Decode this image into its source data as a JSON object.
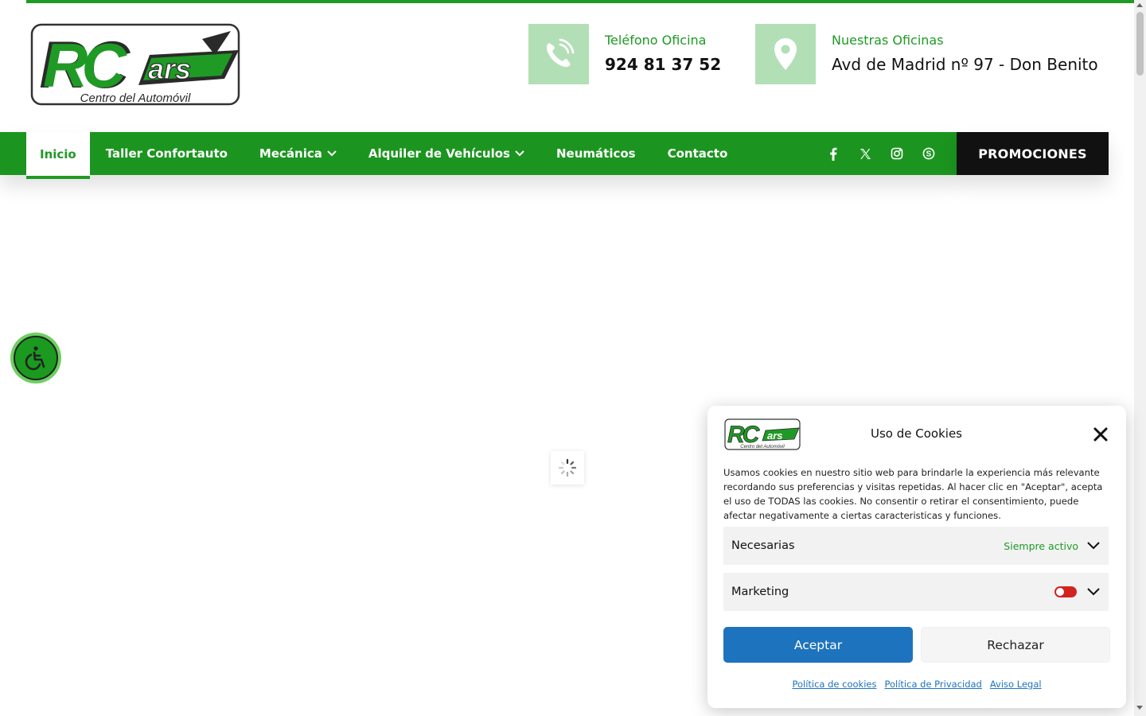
{
  "brand": {
    "logo_text": "RC Cars",
    "logo_subtitle": "Centro del Automóvil",
    "green": "#1b951f",
    "light_green": "#b3dfb6",
    "dark": "#111111"
  },
  "header": {
    "phone": {
      "icon": "phone-icon",
      "label": "Teléfono Oficina",
      "value": "924 81 37 52"
    },
    "office": {
      "icon": "location-pin-icon",
      "label": "Nuestras Oficinas",
      "value": "Avd de Madrid nº 97 - Don Benito"
    }
  },
  "nav": {
    "items": [
      {
        "label": "Inicio",
        "active": true
      },
      {
        "label": "Taller Confortauto"
      },
      {
        "label": "Mecánica",
        "dropdown": true
      },
      {
        "label": "Alquiler de Vehículos",
        "dropdown": true
      },
      {
        "label": "Neumáticos"
      },
      {
        "label": "Contacto"
      }
    ],
    "social_icons": [
      "facebook-icon",
      "x-twitter-icon",
      "instagram-icon",
      "skype-icon"
    ],
    "promo_label": "PROMOCIONES"
  },
  "accessibility": {
    "icon": "accessibility-icon"
  },
  "cookie": {
    "title": "Uso de Cookies",
    "text": "Usamos cookies en nuestro sitio web para brindarle la experiencia más relevante recordando sus preferencias y visitas repetidas. Al hacer clic en \"Aceptar\", acepta el uso de TODAS las cookies. No consentir o retirar el consentimiento, puede afectar negativamente a ciertas caracteristicas y funciones.",
    "categories": [
      {
        "label": "Necesarias",
        "status": "Siempre activo"
      },
      {
        "label": "Marketing",
        "enabled": false,
        "toggle_color": "#d3231f"
      }
    ],
    "accept_label": "Aceptar",
    "reject_label": "Rechazar",
    "accept_color": "#1e73be",
    "links": [
      "Política de cookies",
      "Política de Privacidad",
      "Aviso Legal"
    ]
  }
}
